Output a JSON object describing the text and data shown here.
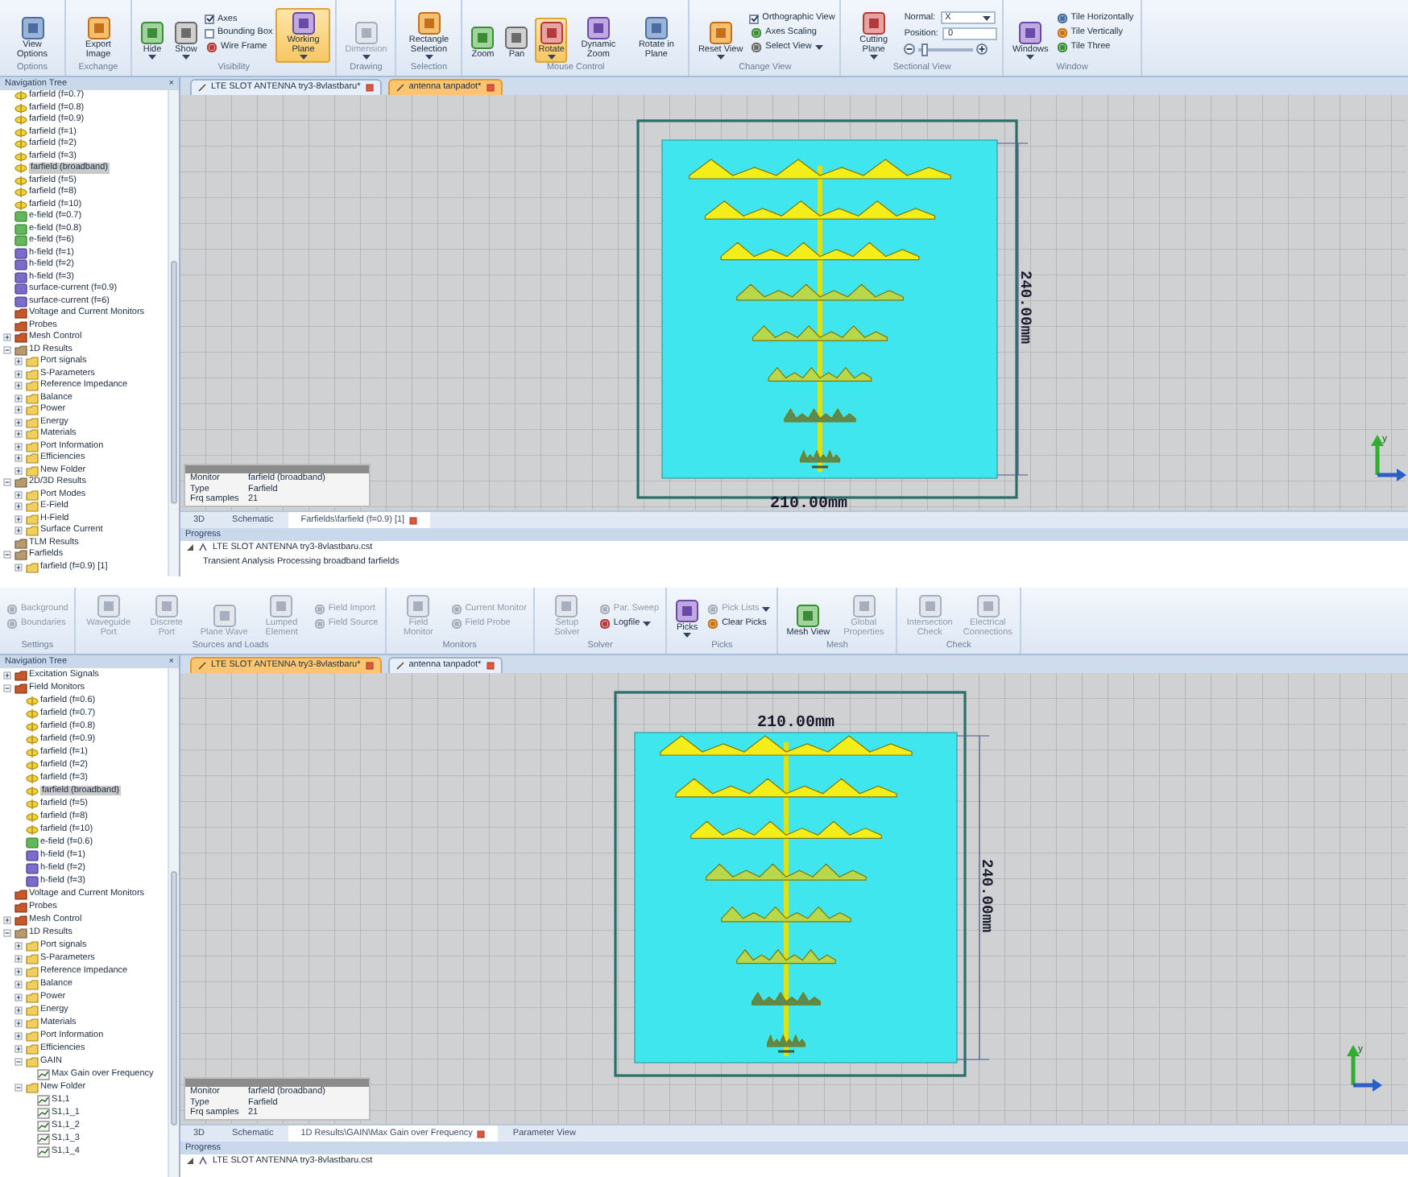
{
  "screens": [
    {
      "ribbon": [
        {
          "label": "Options",
          "items": [
            {
              "kind": "large",
              "label": "View Options",
              "active": false
            }
          ]
        },
        {
          "label": "Exchange",
          "items": [
            {
              "kind": "large",
              "label": "Export Image",
              "active": false
            }
          ]
        },
        {
          "label": "Visibility",
          "items": [
            {
              "kind": "large",
              "label": "Hide",
              "active": false,
              "dropdown": true
            },
            {
              "kind": "large",
              "label": "Show",
              "active": false,
              "dropdown": true
            },
            {
              "kind": "column",
              "items": [
                {
                  "kind": "check",
                  "label": "Axes",
                  "checked": true
                },
                {
                  "kind": "check",
                  "label": "Bounding Box",
                  "checked": false
                },
                {
                  "kind": "small",
                  "label": "Wire Frame"
                }
              ]
            },
            {
              "kind": "large",
              "label": "Working Plane",
              "active": true,
              "dropdown": true
            }
          ]
        },
        {
          "label": "Drawing",
          "items": [
            {
              "kind": "large",
              "label": "Dimension",
              "active": false,
              "disabled": true,
              "dropdown": true
            }
          ]
        },
        {
          "label": "Selection",
          "items": [
            {
              "kind": "large",
              "label": "Rectangle Selection",
              "active": false,
              "dropdown": true
            }
          ]
        },
        {
          "label": "Mouse Control",
          "items": [
            {
              "kind": "large",
              "label": "Zoom",
              "active": false
            },
            {
              "kind": "large",
              "label": "Pan",
              "active": false
            },
            {
              "kind": "large",
              "label": "Rotate",
              "active": true,
              "dropdown": true
            },
            {
              "kind": "large",
              "label": "Dynamic Zoom",
              "active": false
            },
            {
              "kind": "large",
              "label": "Rotate in Plane",
              "active": false
            }
          ]
        },
        {
          "label": "Change View",
          "items": [
            {
              "kind": "large",
              "label": "Reset View",
              "active": false,
              "dropdown": true
            },
            {
              "kind": "column",
              "items": [
                {
                  "kind": "check",
                  "label": "Orthographic View",
                  "checked": true
                },
                {
                  "kind": "small",
                  "label": "Axes Scaling"
                },
                {
                  "kind": "small",
                  "label": "Select View",
                  "dropdown": true
                }
              ]
            }
          ]
        },
        {
          "label": "Sectional View",
          "items": [
            {
              "kind": "large",
              "label": "Cutting Plane",
              "active": false,
              "dropdown": true
            },
            {
              "kind": "column",
              "items": [
                {
                  "kind": "field",
                  "label": "Normal:",
                  "value": "X",
                  "dropdown": true
                },
                {
                  "kind": "field",
                  "label": "Position:",
                  "value": "0"
                },
                {
                  "kind": "slider",
                  "level": 0.1
                }
              ]
            }
          ]
        },
        {
          "label": "Window",
          "items": [
            {
              "kind": "large",
              "label": "Windows",
              "active": false,
              "dropdown": true
            },
            {
              "kind": "column",
              "items": [
                {
                  "kind": "small",
                  "label": "Tile Horizontally"
                },
                {
                  "kind": "small",
                  "label": "Tile Vertically"
                },
                {
                  "kind": "small",
                  "label": "Tile Three"
                }
              ]
            }
          ]
        }
      ],
      "navigation": {
        "title": "Navigation Tree",
        "close": "×",
        "tree": [
          {
            "children": [
              {
                "label": "farfield (f=0.7)",
                "kind": "farfield",
                "selected": false
              },
              {
                "label": "farfield (f=0.8)",
                "kind": "farfield",
                "selected": false
              },
              {
                "label": "farfield (f=0.9)",
                "kind": "farfield",
                "selected": false
              },
              {
                "label": "farfield (f=1)",
                "kind": "farfield",
                "selected": false
              },
              {
                "label": "farfield (f=2)",
                "kind": "farfield",
                "selected": false
              },
              {
                "label": "farfield (f=3)",
                "kind": "farfield",
                "selected": false
              },
              {
                "label": "farfield (broadband)",
                "kind": "farfield",
                "selected": true
              },
              {
                "label": "farfield (f=5)",
                "kind": "farfield",
                "selected": false
              },
              {
                "label": "farfield (f=8)",
                "kind": "farfield",
                "selected": false
              },
              {
                "label": "farfield (f=10)",
                "kind": "farfield",
                "selected": false
              },
              {
                "label": "e-field (f=0.7)",
                "kind": "efield",
                "selected": false
              },
              {
                "label": "e-field (f=0.8)",
                "kind": "efield",
                "selected": false
              },
              {
                "label": "e-field (f=6)",
                "kind": "efield",
                "selected": false
              },
              {
                "label": "h-field (f=1)",
                "kind": "hfield",
                "selected": false
              },
              {
                "label": "h-field (f=2)",
                "kind": "hfield",
                "selected": false
              },
              {
                "label": "h-field (f=3)",
                "kind": "hfield",
                "selected": false
              },
              {
                "label": "surface-current (f=0.9)",
                "kind": "hfield",
                "selected": false
              },
              {
                "label": "surface-current (f=6)",
                "kind": "hfield",
                "selected": false
              }
            ]
          },
          {
            "label": "Voltage and Current Monitors",
            "kind": "monitor",
            "selected": false
          },
          {
            "label": "Probes",
            "kind": "monitor",
            "selected": false
          },
          {
            "label": "Mesh Control",
            "kind": "monitor",
            "selected": false,
            "expanded": false
          },
          {
            "label": "1D Results",
            "kind": "results",
            "selected": false,
            "expanded": true,
            "children": [
              {
                "label": "Port signals",
                "kind": "folder",
                "selected": false,
                "expanded": false
              },
              {
                "label": "S-Parameters",
                "kind": "folder",
                "selected": false,
                "expanded": false
              },
              {
                "label": "Reference Impedance",
                "kind": "folder",
                "selected": false,
                "expanded": false
              },
              {
                "label": "Balance",
                "kind": "folder",
                "selected": false,
                "expanded": false
              },
              {
                "label": "Power",
                "kind": "folder",
                "selected": false,
                "expanded": false
              },
              {
                "label": "Energy",
                "kind": "folder",
                "selected": false,
                "expanded": false
              },
              {
                "label": "Materials",
                "kind": "folder",
                "selected": false,
                "expanded": false
              },
              {
                "label": "Port Information",
                "kind": "folder",
                "selected": false,
                "expanded": false
              },
              {
                "label": "Efficiencies",
                "kind": "folder",
                "selected": false,
                "expanded": false
              },
              {
                "label": "New Folder",
                "kind": "folder",
                "selected": false,
                "expanded": false
              }
            ]
          },
          {
            "label": "2D/3D Results",
            "kind": "results",
            "selected": false,
            "expanded": true,
            "children": [
              {
                "label": "Port Modes",
                "kind": "folder",
                "selected": false,
                "expanded": false
              },
              {
                "label": "E-Field",
                "kind": "folder",
                "selected": false,
                "expanded": false
              },
              {
                "label": "H-Field",
                "kind": "folder",
                "selected": false,
                "expanded": false
              },
              {
                "label": "Surface Current",
                "kind": "folder",
                "selected": false,
                "expanded": false
              }
            ]
          },
          {
            "label": "TLM Results",
            "kind": "results",
            "selected": false
          },
          {
            "label": "Farfields",
            "kind": "results",
            "selected": false,
            "expanded": true,
            "children": [
              {
                "label": "farfield (f=0.9) [1]",
                "kind": "folder",
                "selected": false,
                "expanded": false
              }
            ]
          }
        ]
      },
      "document_tabs": [
        {
          "label": "LTE SLOT ANTENNA try3-8vlastbaru*",
          "selected": false
        },
        {
          "label": "antenna tanpadot*",
          "selected": true
        }
      ],
      "canvas": {
        "horizontal_dimension": "210.00mm",
        "vertical_dimension": "240.00mm",
        "axis_label": "y"
      },
      "info": [
        {
          "key": "Monitor",
          "value": "farfield (broadband)"
        },
        {
          "key": "Type",
          "value": "Farfield"
        },
        {
          "key": "Frq samples",
          "value": "21"
        }
      ],
      "view_tabs": [
        {
          "label": "3D",
          "selected": false
        },
        {
          "label": "Schematic",
          "selected": false
        },
        {
          "label": "Farfields\\farfield (f=0.9) [1]",
          "selected": true
        }
      ],
      "progress": {
        "title": "Progress",
        "project": "LTE SLOT ANTENNA try3-8vlastbaru.cst",
        "lines": [
          "Transient Analysis Processing broadband farfields"
        ]
      }
    },
    {
      "ribbon": [
        {
          "label": "Settings",
          "items": [
            {
              "kind": "column",
              "items": [
                {
                  "kind": "small",
                  "label": "Background",
                  "disabled": true
                },
                {
                  "kind": "small",
                  "label": "Boundaries",
                  "disabled": true
                }
              ]
            }
          ]
        },
        {
          "label": "Sources and Loads",
          "items": [
            {
              "kind": "large",
              "label": "Waveguide Port",
              "active": false,
              "disabled": true
            },
            {
              "kind": "large",
              "label": "Discrete Port",
              "active": false,
              "disabled": true
            },
            {
              "kind": "large",
              "label": "Plane Wave",
              "active": false,
              "disabled": true
            },
            {
              "kind": "large",
              "label": "Lumped Element",
              "active": false,
              "disabled": true
            },
            {
              "kind": "column",
              "items": [
                {
                  "kind": "small",
                  "label": "Field Import",
                  "disabled": true
                },
                {
                  "kind": "small",
                  "label": "Field Source",
                  "disabled": true
                }
              ]
            }
          ]
        },
        {
          "label": "Monitors",
          "items": [
            {
              "kind": "large",
              "label": "Field Monitor",
              "active": false,
              "disabled": true
            },
            {
              "kind": "column",
              "items": [
                {
                  "kind": "small",
                  "label": "Current Monitor",
                  "disabled": true
                },
                {
                  "kind": "small",
                  "label": "Field Probe",
                  "disabled": true
                }
              ]
            }
          ]
        },
        {
          "label": "Solver",
          "items": [
            {
              "kind": "large",
              "label": "Setup Solver",
              "active": false,
              "disabled": true
            },
            {
              "kind": "column",
              "items": [
                {
                  "kind": "small",
                  "label": "Par. Sweep",
                  "disabled": true
                },
                {
                  "kind": "small",
                  "label": "Logfile",
                  "dropdown": true
                }
              ]
            }
          ]
        },
        {
          "label": "Picks",
          "items": [
            {
              "kind": "large",
              "label": "Picks",
              "active": false,
              "dropdown": true
            },
            {
              "kind": "column",
              "items": [
                {
                  "kind": "small",
                  "label": "Pick Lists",
                  "disabled": true,
                  "dropdown": true
                },
                {
                  "kind": "small",
                  "label": "Clear Picks"
                }
              ]
            }
          ]
        },
        {
          "label": "Mesh",
          "items": [
            {
              "kind": "large",
              "label": "Mesh View",
              "active": false
            },
            {
              "kind": "large",
              "label": "Global Properties",
              "active": false,
              "disabled": true
            }
          ]
        },
        {
          "label": "Check",
          "items": [
            {
              "kind": "large",
              "label": "Intersection Check",
              "active": false,
              "disabled": true
            },
            {
              "kind": "large",
              "label": "Electrical Connections",
              "active": false,
              "disabled": true
            }
          ]
        }
      ],
      "navigation": {
        "title": "Navigation Tree",
        "close": "×",
        "tree": [
          {
            "label": "Excitation Signals",
            "kind": "monitor",
            "selected": false,
            "expanded": false
          },
          {
            "label": "Field Monitors",
            "kind": "monitor",
            "selected": false,
            "expanded": true,
            "children": [
              {
                "label": "farfield (f=0.6)",
                "kind": "farfield",
                "selected": false
              },
              {
                "label": "farfield (f=0.7)",
                "kind": "farfield",
                "selected": false
              },
              {
                "label": "farfield (f=0.8)",
                "kind": "farfield",
                "selected": false
              },
              {
                "label": "farfield (f=0.9)",
                "kind": "farfield",
                "selected": false
              },
              {
                "label": "farfield (f=1)",
                "kind": "farfield",
                "selected": false
              },
              {
                "label": "farfield (f=2)",
                "kind": "farfield",
                "selected": false
              },
              {
                "label": "farfield (f=3)",
                "kind": "farfield",
                "selected": false
              },
              {
                "label": "farfield (broadband)",
                "kind": "farfield",
                "selected": true
              },
              {
                "label": "farfield (f=5)",
                "kind": "farfield",
                "selected": false
              },
              {
                "label": "farfield (f=8)",
                "kind": "farfield",
                "selected": false
              },
              {
                "label": "farfield (f=10)",
                "kind": "farfield",
                "selected": false
              },
              {
                "label": "e-field (f=0.6)",
                "kind": "efield",
                "selected": false
              },
              {
                "label": "h-field (f=1)",
                "kind": "hfield",
                "selected": false
              },
              {
                "label": "h-field (f=2)",
                "kind": "hfield",
                "selected": false
              },
              {
                "label": "h-field (f=3)",
                "kind": "hfield",
                "selected": false
              }
            ]
          },
          {
            "label": "Voltage and Current Monitors",
            "kind": "monitor",
            "selected": false
          },
          {
            "label": "Probes",
            "kind": "monitor",
            "selected": false
          },
          {
            "label": "Mesh Control",
            "kind": "monitor",
            "selected": false,
            "expanded": false
          },
          {
            "label": "1D Results",
            "kind": "results",
            "selected": false,
            "expanded": true,
            "children": [
              {
                "label": "Port signals",
                "kind": "folder",
                "selected": false,
                "expanded": false
              },
              {
                "label": "S-Parameters",
                "kind": "folder",
                "selected": false,
                "expanded": false
              },
              {
                "label": "Reference Impedance",
                "kind": "folder",
                "selected": false,
                "expanded": false
              },
              {
                "label": "Balance",
                "kind": "folder",
                "selected": false,
                "expanded": false
              },
              {
                "label": "Power",
                "kind": "folder",
                "selected": false,
                "expanded": false
              },
              {
                "label": "Energy",
                "kind": "folder",
                "selected": false,
                "expanded": false
              },
              {
                "label": "Materials",
                "kind": "folder",
                "selected": false,
                "expanded": false
              },
              {
                "label": "Port Information",
                "kind": "folder",
                "selected": false,
                "expanded": false
              },
              {
                "label": "Efficiencies",
                "kind": "folder",
                "selected": false,
                "expanded": false
              },
              {
                "label": "GAIN",
                "kind": "folder",
                "selected": false,
                "expanded": true,
                "children": [
                  {
                    "label": "Max Gain over Frequency",
                    "kind": "curve",
                    "selected": false
                  }
                ]
              },
              {
                "label": "New Folder",
                "kind": "folder",
                "selected": false,
                "expanded": true,
                "children": [
                  {
                    "label": "S1,1",
                    "kind": "curve",
                    "selected": false
                  },
                  {
                    "label": "S1,1_1",
                    "kind": "curve",
                    "selected": false
                  },
                  {
                    "label": "S1,1_2",
                    "kind": "curve",
                    "selected": false
                  },
                  {
                    "label": "S1,1_3",
                    "kind": "curve",
                    "selected": false
                  },
                  {
                    "label": "S1,1_4",
                    "kind": "curve",
                    "selected": false
                  }
                ]
              }
            ]
          }
        ]
      },
      "document_tabs": [
        {
          "label": "LTE SLOT ANTENNA try3-8vlastbaru*",
          "selected": true
        },
        {
          "label": "antenna tanpadot*",
          "selected": false
        }
      ],
      "canvas": {
        "horizontal_dimension": "210.00mm",
        "vertical_dimension": "240.00mm",
        "axis_label": "y"
      },
      "info": [
        {
          "key": "Monitor",
          "value": "farfield (broadband)"
        },
        {
          "key": "Type",
          "value": "Farfield"
        },
        {
          "key": "Frq samples",
          "value": "21"
        }
      ],
      "view_tabs": [
        {
          "label": "3D",
          "selected": false
        },
        {
          "label": "Schematic",
          "selected": false
        },
        {
          "label": "1D Results\\GAIN\\Max Gain over Frequency",
          "selected": true
        },
        {
          "label": "Parameter View",
          "selected": false
        }
      ],
      "progress": {
        "title": "Progress",
        "project": "LTE SLOT ANTENNA try3-8vlastbaru.cst"
      }
    }
  ]
}
